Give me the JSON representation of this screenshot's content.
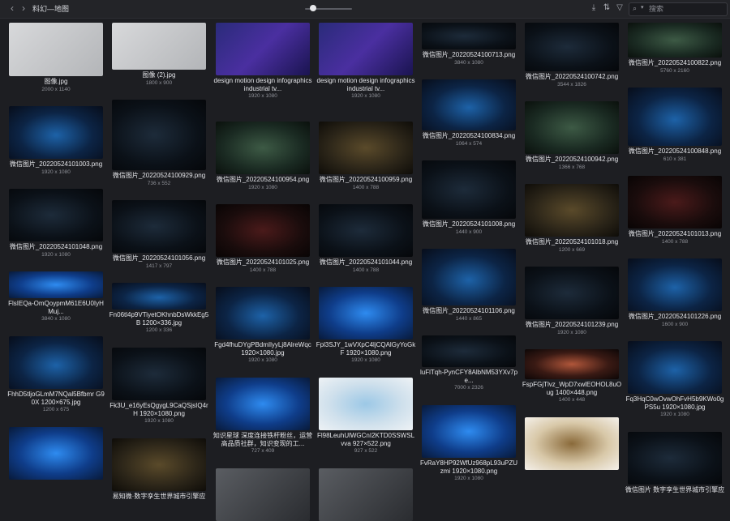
{
  "toolbar": {
    "back_icon": "chevron-left-icon",
    "forward_icon": "chevron-right-icon",
    "folder_title": "料幻—地图",
    "thumbnail_size_fraction": 0.15,
    "search_placeholder": "搜索"
  },
  "grid": {
    "columns": [
      [
        {
          "name": "图像.jpg",
          "size": "2000 x 1140",
          "style": "grey"
        },
        {
          "name": "微信图片_20220524101003.png",
          "size": "1920 x 1080",
          "style": "blue"
        },
        {
          "name": "微信图片_20220524101048.png",
          "size": "1920 x 1080",
          "style": "dark"
        },
        {
          "name": "FlsIEQa-OmQoypmM61E6U0IyHMuj...",
          "size": "3840 x 1080",
          "style": "bright"
        },
        {
          "name": "FhhD5tljoGLmM7NQal5Bfbmr G90X 1200×675.jpg",
          "size": "1200 x 675",
          "style": "blue"
        },
        {
          "name": "",
          "size": "",
          "style": "bright"
        }
      ],
      [
        {
          "name": "图像 (2).jpg",
          "size": "1800 x 900",
          "style": "grey"
        },
        {
          "name": "微信图片_20220524100929.png",
          "size": "736 x 552",
          "style": "dark"
        },
        {
          "name": "微信图片_20220524101056.png",
          "size": "1417 x 797",
          "style": "dark"
        },
        {
          "name": "Fn06tl4p9VTiyetOKhnbDsWkkEg5B 1200×336.jpg",
          "size": "1200 x 336",
          "style": "blue"
        },
        {
          "name": "Fk3U_e16yEsQgygL9CaQSjsIQ4rH 1920×1080.png",
          "size": "1920 x 1080",
          "style": "dark"
        },
        {
          "name": "易知微·数字孪生世界城市引擎应",
          "size": "",
          "style": "gold"
        }
      ],
      [
        {
          "name": "design motion design infographics industrial tv...",
          "size": "1920 x 1080",
          "style": "purple"
        },
        {
          "name": "微信图片_20220524100954.png",
          "size": "1920 x 1080",
          "style": "green"
        },
        {
          "name": "微信图片_20220524101025.png",
          "size": "1400 x 788",
          "style": "red"
        },
        {
          "name": "Fgd4fhuDYgPBdmIlyyLj8AlreWqc 1920×1080.jpg",
          "size": "1920 x 1080",
          "style": "blue"
        },
        {
          "name": "知识星球 深度连接铁杆粉丝，运营高品质社群，知识变现的工...",
          "size": "727 x 409",
          "style": "bright"
        },
        {
          "name": "",
          "size": "",
          "style": "grey2"
        }
      ],
      [
        {
          "name": "design motion design infographics industrial tv...",
          "size": "1920 x 1080",
          "style": "purple"
        },
        {
          "name": "微信图片_20220524100959.png",
          "size": "1400 x 788",
          "style": "gold"
        },
        {
          "name": "微信图片_20220524101044.png",
          "size": "1400 x 788",
          "style": "dark"
        },
        {
          "name": "Fpl3SJY_1wVXpC4ljCQAlGyYoGkF 1920×1080.png",
          "size": "1920 x 1080",
          "style": "bright"
        },
        {
          "name": "Fl98LeuhUlWGCnI2KTD0SSWSLvva 927×522.png",
          "size": "927 x 522",
          "style": "whitemap"
        },
        {
          "name": "",
          "size": "",
          "style": "grey2"
        }
      ],
      [
        {
          "name": "微信图片_20220524100713.png",
          "size": "3840 x 1080",
          "style": "dark"
        },
        {
          "name": "微信图片_20220524100834.png",
          "size": "1064 x 574",
          "style": "blue"
        },
        {
          "name": "微信图片_20220524101008.png",
          "size": "1440 x 900",
          "style": "dark"
        },
        {
          "name": "微信图片_20220524101106.png",
          "size": "1440 x 865",
          "style": "blue"
        },
        {
          "name": "luFlTqh-PynCFY8AlbNM53YXv7pe...",
          "size": "7000 x 2326",
          "style": "dark"
        },
        {
          "name": "FvRaY8HP92WfUz968pL93uPZUzmi 1920×1080.png",
          "size": "1920 x 1080",
          "style": "bright"
        }
      ],
      [
        {
          "name": "微信图片_20220524100742.png",
          "size": "3544 x 1826",
          "style": "dark"
        },
        {
          "name": "微信图片_20220524100942.png",
          "size": "1366 x 768",
          "style": "green"
        },
        {
          "name": "微信图片_20220524101018.png",
          "size": "1200 x 669",
          "style": "gold"
        },
        {
          "name": "微信图片_20220524101239.png",
          "size": "1920 x 1080",
          "style": "dark"
        },
        {
          "name": "FspFGjTlvz_WpD7xwlEOHOL8uOug 1400×448.png",
          "size": "1400 x 448",
          "style": "orange"
        },
        {
          "name": "",
          "size": "",
          "style": "terrain"
        }
      ],
      [
        {
          "name": "微信图片_20220524100822.png",
          "size": "5760 x 2160",
          "style": "green"
        },
        {
          "name": "微信图片_20220524100848.png",
          "size": "610 x 381",
          "style": "blue"
        },
        {
          "name": "微信图片_20220524101013.png",
          "size": "1400 x 788",
          "style": "red"
        },
        {
          "name": "微信图片_20220524101226.png",
          "size": "1600 x 900",
          "style": "blue"
        },
        {
          "name": "Fq3HqC0wOvwOhFvH5b9KWo0gPS5u 1920×1080.jpg",
          "size": "1920 x 1080",
          "style": "blue"
        },
        {
          "name": "微信图片 数字孪生世界城市引擎应",
          "size": "",
          "style": "dark"
        }
      ]
    ]
  }
}
